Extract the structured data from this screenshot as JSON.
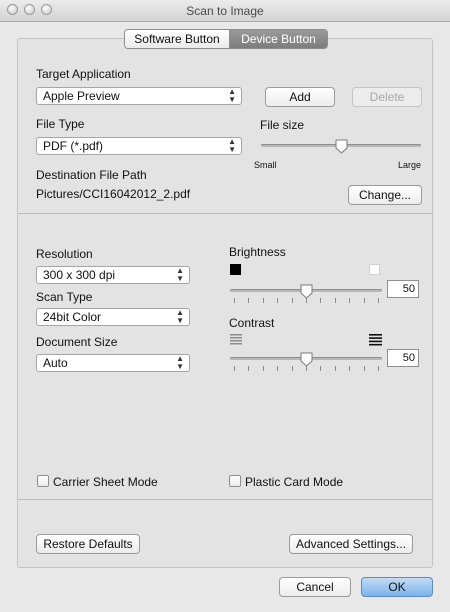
{
  "window": {
    "title": "Scan to Image"
  },
  "tabs": [
    {
      "label": "Software Button",
      "selected": false
    },
    {
      "label": "Device Button",
      "selected": true
    }
  ],
  "target_application": {
    "label": "Target Application",
    "selected": "Apple Preview",
    "add_label": "Add",
    "delete_label": "Delete"
  },
  "file_type": {
    "label": "File Type",
    "selected": "PDF (*.pdf)"
  },
  "file_size": {
    "label": "File size",
    "min_label": "Small",
    "max_label": "Large",
    "level": 0.5
  },
  "destination": {
    "label": "Destination File Path",
    "path": "Pictures/CCI16042012_2.pdf",
    "change_label": "Change..."
  },
  "resolution": {
    "label": "Resolution",
    "selected": "300 x 300 dpi"
  },
  "scan_type": {
    "label": "Scan Type",
    "selected": "24bit Color"
  },
  "document_size": {
    "label": "Document Size",
    "selected": "Auto"
  },
  "brightness": {
    "label": "Brightness",
    "value": "50",
    "level": 0.5
  },
  "contrast": {
    "label": "Contrast",
    "value": "50",
    "level": 0.5
  },
  "carrier_sheet": {
    "label": "Carrier Sheet Mode",
    "checked": false
  },
  "plastic_card": {
    "label": "Plastic Card Mode",
    "checked": false
  },
  "footer": {
    "restore_label": "Restore Defaults",
    "advanced_label": "Advanced Settings...",
    "cancel_label": "Cancel",
    "ok_label": "OK"
  },
  "colors": {
    "ok_button": "#7eb2ea",
    "tab_selected": "#8a8a8a"
  }
}
